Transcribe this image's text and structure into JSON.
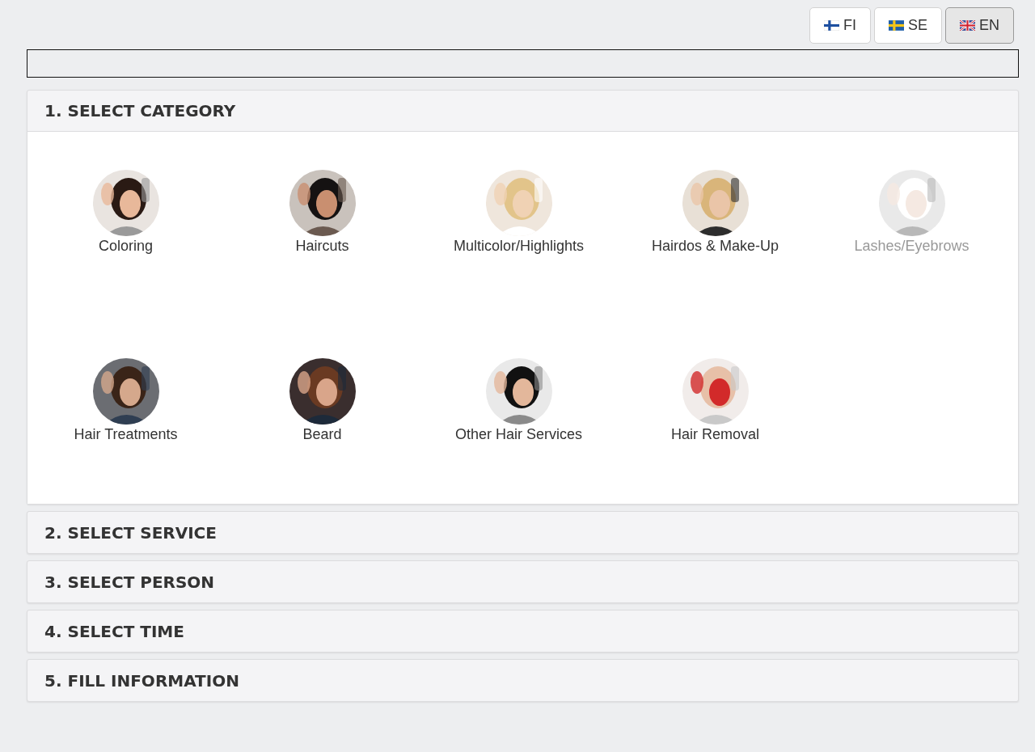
{
  "languages": [
    {
      "label": "FI",
      "kind": "finland",
      "selected": false
    },
    {
      "label": "SE",
      "kind": "sweden",
      "selected": false
    },
    {
      "label": "EN",
      "kind": "uk",
      "selected": true
    }
  ],
  "sections": [
    {
      "title": "1. SELECT CATEGORY",
      "expanded": true,
      "categories": [
        {
          "label": "Coloring",
          "disabled": false,
          "kind": "picture"
        },
        {
          "label": "Haircuts",
          "disabled": false,
          "kind": "picture"
        },
        {
          "label": "Multicolor/Highlights",
          "disabled": false,
          "kind": "picture"
        },
        {
          "label": "Hairdos & Make-Up",
          "disabled": false,
          "kind": "picture"
        },
        {
          "label": "Lashes/Eyebrows",
          "disabled": true,
          "kind": "picture"
        },
        {
          "label": "Hair Treatments",
          "disabled": false,
          "kind": "picture"
        },
        {
          "label": "Beard",
          "disabled": false,
          "kind": "picture"
        },
        {
          "label": "Other Hair Services",
          "disabled": false,
          "kind": "picture"
        },
        {
          "label": "Hair Removal",
          "disabled": false,
          "kind": "picture"
        }
      ]
    },
    {
      "title": "2. SELECT SERVICE",
      "expanded": false
    },
    {
      "title": "3. SELECT PERSON",
      "expanded": false
    },
    {
      "title": "4. SELECT TIME",
      "expanded": false
    },
    {
      "title": "5. FILL INFORMATION",
      "expanded": false
    }
  ]
}
